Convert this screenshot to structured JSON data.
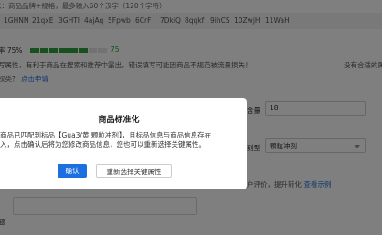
{
  "form": {
    "hint": "以：商品品牌+规格，最多输入60个汉字（120个字符）",
    "tags": [
      "1GHNN",
      "21qxE",
      "3GHTI",
      "4ajAq",
      "5Fpwb",
      "6CrF",
      "7DkiQ",
      "8qqkf",
      "9ihCS",
      "10ZwjH",
      "11WaH"
    ],
    "rate_label": "率 75%",
    "progress": 0.75,
    "progress_value": "75",
    "note": "写属性，有利于商品在搜索和推荐中露出，错误填写可能因商品不规范被流量损失！",
    "right_link": "没有合适的属",
    "apply_text": "权类？",
    "apply_link": "点击申请",
    "weight_label": "含量",
    "weight_value": "18",
    "form_label": "刻型",
    "form_value": "颗粒冲剂",
    "tip_text": "户评价，提升转化",
    "tip_link": "查看示例",
    "side_label": "题"
  },
  "dialog": {
    "title": "商品标准化",
    "body_line1": "商品已匹配到标品【Gua3/黄 颗粒冲剂】，且标品信息与商品信息存在",
    "body_line2": "入，点击确认后将为您修改商品信息，您也可以重新选择关键属性。",
    "confirm": "确认",
    "reselect": "重新选择关键属性"
  }
}
